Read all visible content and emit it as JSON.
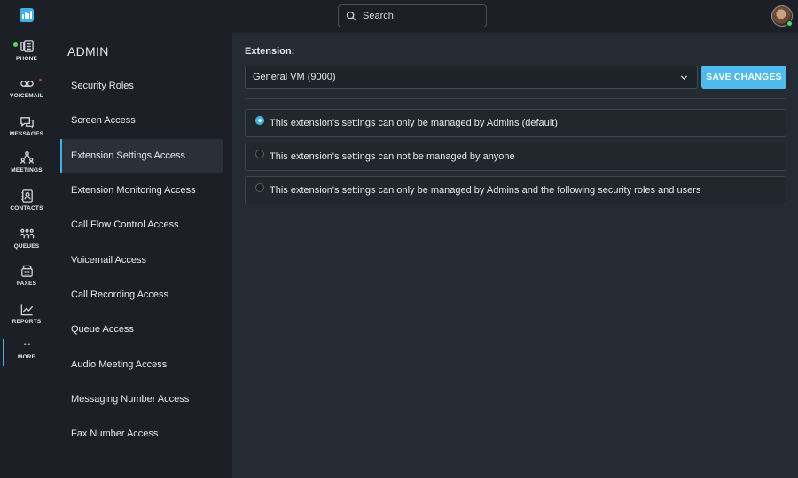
{
  "rail": {
    "items": [
      {
        "label": "PHONE",
        "icon": "phone-icon"
      },
      {
        "label": "VOICEMAIL",
        "icon": "voicemail-icon"
      },
      {
        "label": "MESSAGES",
        "icon": "messages-icon"
      },
      {
        "label": "MEETINGS",
        "icon": "meetings-icon"
      },
      {
        "label": "CONTACTS",
        "icon": "contacts-icon"
      },
      {
        "label": "QUEUES",
        "icon": "queues-icon"
      },
      {
        "label": "FAXES",
        "icon": "fax-icon"
      },
      {
        "label": "REPORTS",
        "icon": "reports-icon"
      },
      {
        "label": "MORE",
        "icon": "more-icon"
      }
    ]
  },
  "search": {
    "placeholder": "Search"
  },
  "sidebar": {
    "title": "ADMIN",
    "items": [
      "Security Roles",
      "Screen Access",
      "Extension Settings Access",
      "Extension Monitoring Access",
      "Call Flow Control Access",
      "Voicemail Access",
      "Call Recording Access",
      "Queue Access",
      "Audio Meeting Access",
      "Messaging Number Access",
      "Fax Number Access"
    ],
    "active_index": 2
  },
  "main": {
    "extension_label": "Extension:",
    "extension_value": "General VM (9000)",
    "save_label": "SAVE CHANGES",
    "options": [
      {
        "label": "This extension's settings can only be managed by Admins (default)",
        "checked": true
      },
      {
        "label": "This extension's settings can not be managed by anyone",
        "checked": false
      },
      {
        "label": "This extension's settings can only be managed by Admins and the following security roles and users",
        "checked": false
      }
    ]
  },
  "colors": {
    "accent": "#3fb0e8",
    "save_button": "#4fbbec",
    "status_online": "#5cd65c"
  }
}
